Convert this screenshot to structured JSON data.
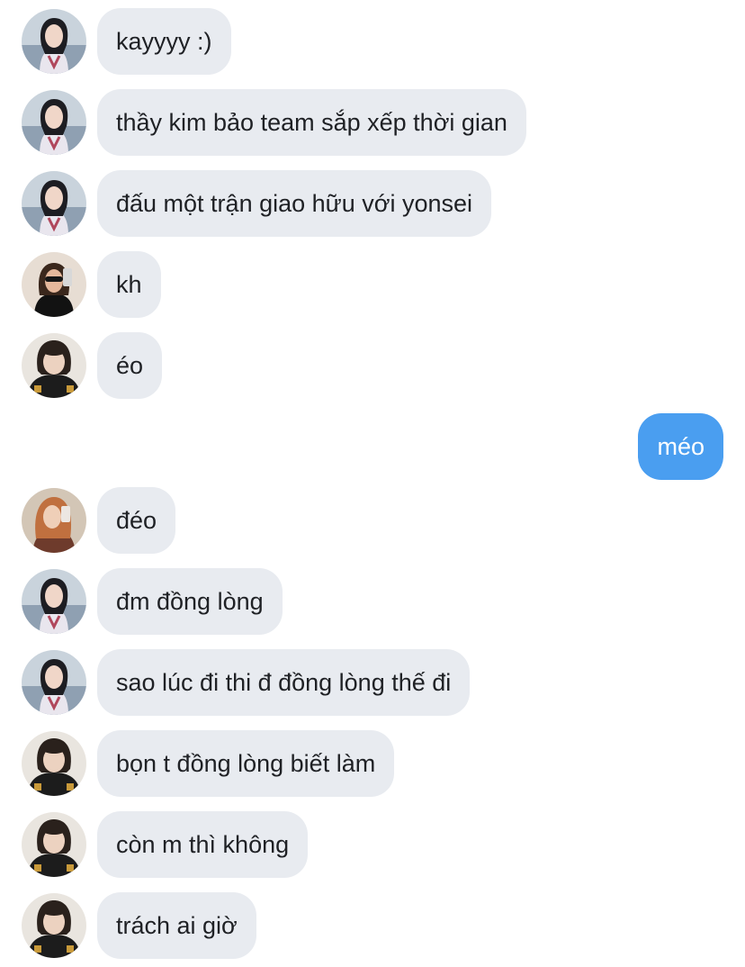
{
  "messages": [
    {
      "text": "kayyyy :)",
      "avatar": "user-a",
      "direction": "in"
    },
    {
      "text": "thầy kim bảo team sắp xếp thời gian",
      "avatar": "user-a",
      "direction": "in"
    },
    {
      "text": "đấu một trận giao hữu với yonsei",
      "avatar": "user-a",
      "direction": "in"
    },
    {
      "text": "kh",
      "avatar": "user-b",
      "direction": "in"
    },
    {
      "text": "éo",
      "avatar": "user-c",
      "direction": "in"
    },
    {
      "text": "méo",
      "direction": "out"
    },
    {
      "text": "đéo",
      "avatar": "user-d",
      "direction": "in"
    },
    {
      "text": "đm đồng lòng",
      "avatar": "user-a",
      "direction": "in"
    },
    {
      "text": "sao lúc đi thi đ đồng lòng thế đi",
      "avatar": "user-a",
      "direction": "in"
    },
    {
      "text": "bọn t đồng lòng biết làm",
      "avatar": "user-c",
      "direction": "in"
    },
    {
      "text": "còn m thì không",
      "avatar": "user-c",
      "direction": "in"
    },
    {
      "text": "trách ai giờ",
      "avatar": "user-c",
      "direction": "in"
    }
  ],
  "colors": {
    "incoming_bubble": "#e8ebf0",
    "outgoing_bubble": "#4a9ef0",
    "incoming_text": "#1f2125",
    "outgoing_text": "#ffffff"
  }
}
